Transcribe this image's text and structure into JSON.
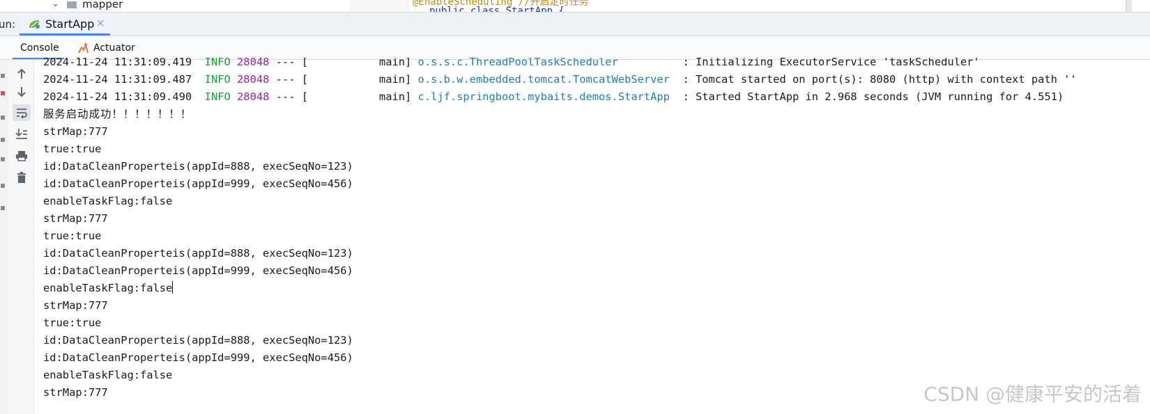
{
  "project_tree": {
    "folder_label": "mapper"
  },
  "editor": {
    "line1": "@EnableScheduling  //开启定时任务",
    "line2": "public class StartApp {"
  },
  "run_bar": {
    "label": "un:",
    "tab_label": "StartApp",
    "close": "×"
  },
  "console_tabs": {
    "console": "Console",
    "actuator": "Actuator"
  },
  "log_lines": [
    {
      "ts": "2024-11-24 11:31:09.419",
      "level": "INFO",
      "pid": "28048",
      "sep": "--- [",
      "thread": "           main]",
      "logger": "o.s.s.c.ThreadPoolTaskScheduler",
      "msg": "          : Initializing ExecutorService 'taskScheduler'"
    },
    {
      "ts": "2024-11-24 11:31:09.487",
      "level": "INFO",
      "pid": "28048",
      "sep": "--- [",
      "thread": "           main]",
      "logger": "o.s.b.w.embedded.tomcat.TomcatWebServer",
      "msg": "  : Tomcat started on port(s): 8080 (http) with context path ''"
    },
    {
      "ts": "2024-11-24 11:31:09.490",
      "level": "INFO",
      "pid": "28048",
      "sep": "--- [",
      "thread": "           main]",
      "logger": "c.ljf.springboot.mybaits.demos.StartApp",
      "msg": "  : Started StartApp in 2.968 seconds (JVM running for 4.551)"
    }
  ],
  "output_lines": [
    "服务启动成功！！！！！！！",
    "strMap:777",
    "true:true",
    "id:DataCleanProperteis(appId=888, execSeqNo=123)",
    "id:DataCleanProperteis(appId=999, execSeqNo=456)",
    "enableTaskFlag:false",
    "strMap:777",
    "true:true",
    "id:DataCleanProperteis(appId=888, execSeqNo=123)",
    "id:DataCleanProperteis(appId=999, execSeqNo=456)",
    "enableTaskFlag:false",
    "strMap:777",
    "true:true",
    "id:DataCleanProperteis(appId=888, execSeqNo=123)",
    "id:DataCleanProperteis(appId=999, execSeqNo=456)",
    "enableTaskFlag:false",
    "strMap:777"
  ],
  "toolbar_icons": [
    "arrow-up-icon",
    "arrow-down-icon",
    "soft-wrap-icon",
    "scroll-to-end-icon",
    "print-icon",
    "trash-icon"
  ],
  "watermark": "CSDN @健康平安的活着",
  "colors": {
    "info": "#1a9a3a",
    "pid": "#a01fae",
    "logger": "#1f7fb3",
    "accent": "#4a86e8"
  }
}
